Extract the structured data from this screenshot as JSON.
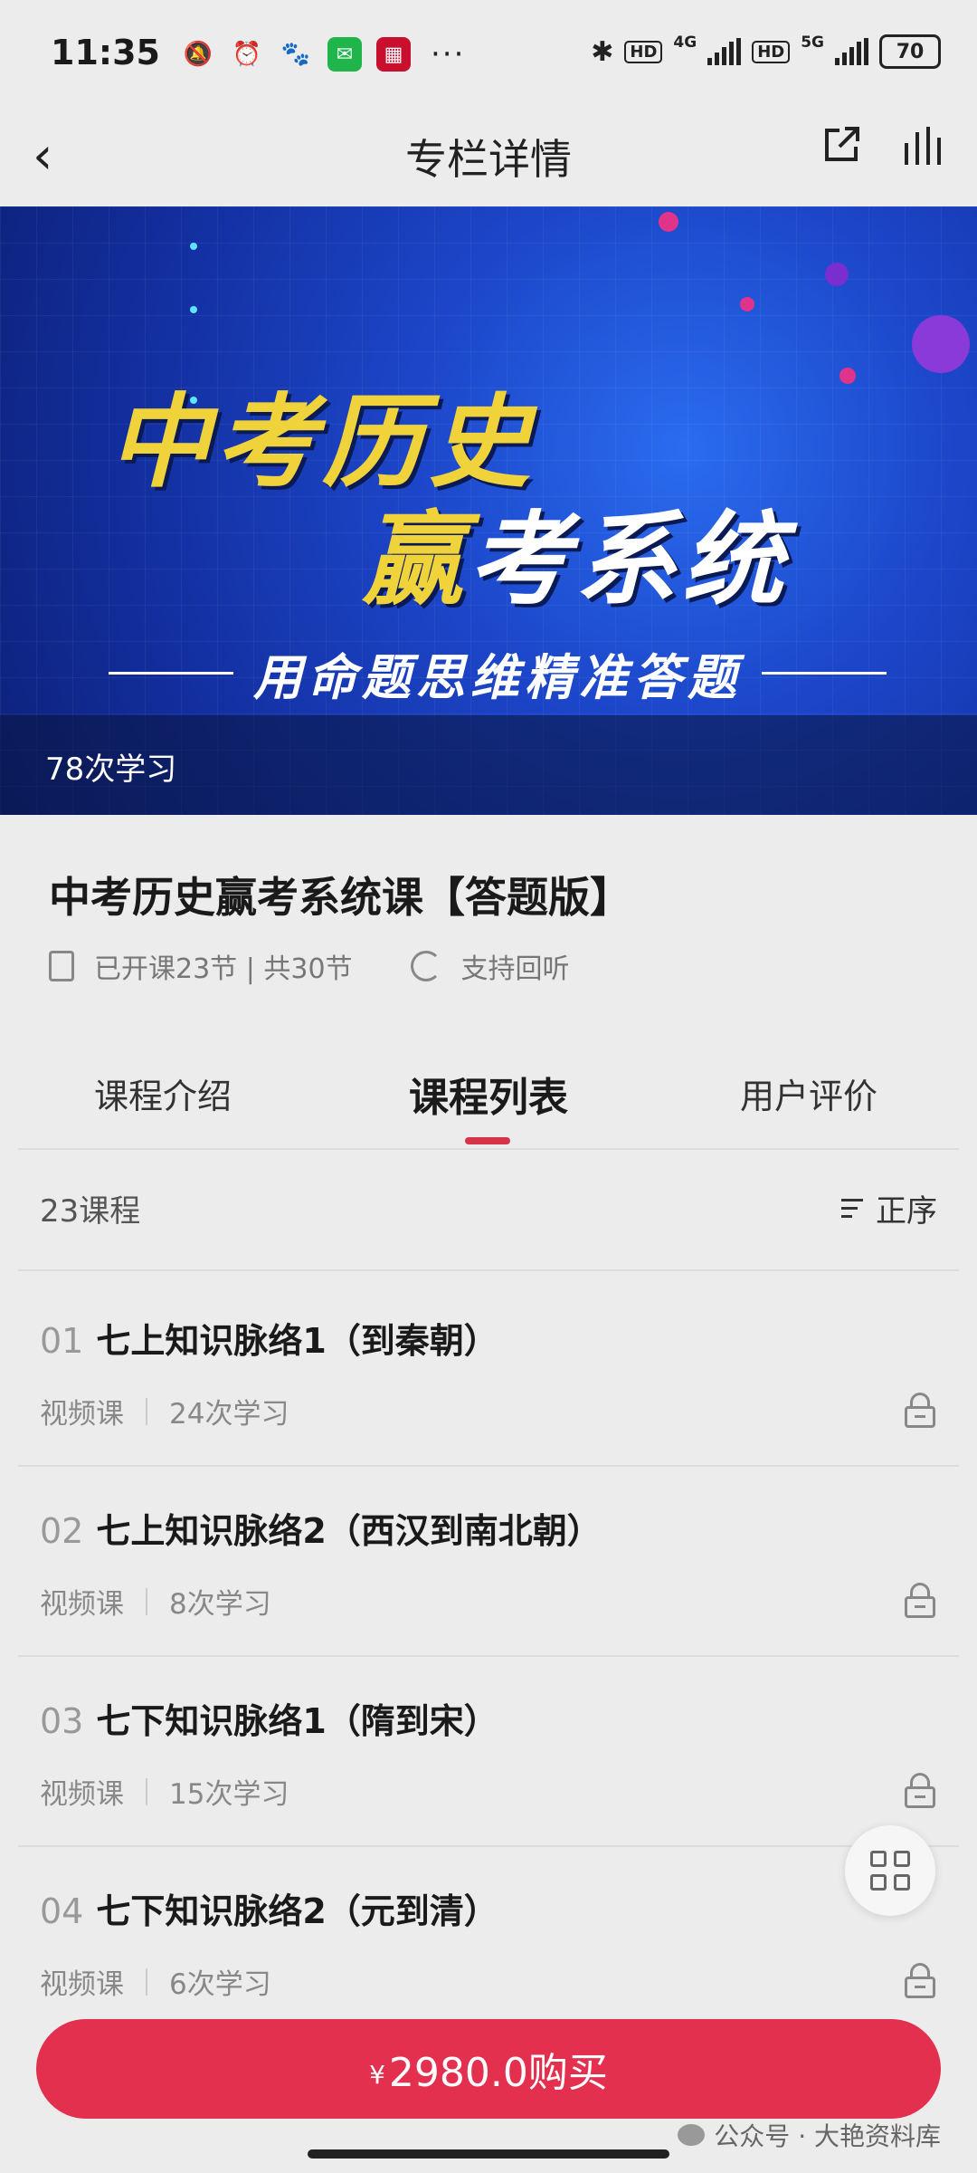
{
  "status_bar": {
    "time": "11:35",
    "network1": "4G",
    "network2": "5G",
    "hd": "HD",
    "battery": "70",
    "more": "···"
  },
  "header": {
    "title": "专栏详情",
    "back_icon": "‹"
  },
  "banner": {
    "title_line1": "中考历史",
    "title_line2_yellow": "赢",
    "title_line2_rest": "考系统",
    "subtitle": "用命题思维精准答题",
    "study_count": "78次学习"
  },
  "course": {
    "title": "中考历史赢考系统课【答题版】",
    "lessons_info": "已开课23节 | 共30节",
    "replay": "支持回听"
  },
  "tabs": [
    {
      "label": "课程介绍"
    },
    {
      "label": "课程列表"
    },
    {
      "label": "用户评价"
    }
  ],
  "list": {
    "count_label": "23课程",
    "sort_label": "正序",
    "items": [
      {
        "num": "01",
        "title": "七上知识脉络1（到秦朝）",
        "type": "视频课",
        "views": "24次学习"
      },
      {
        "num": "02",
        "title": "七上知识脉络2（西汉到南北朝）",
        "type": "视频课",
        "views": "8次学习"
      },
      {
        "num": "03",
        "title": "七下知识脉络1（隋到宋）",
        "type": "视频课",
        "views": "15次学习"
      },
      {
        "num": "04",
        "title": "七下知识脉络2（元到清）",
        "type": "视频课",
        "views": "6次学习"
      }
    ]
  },
  "buy": {
    "currency": "¥",
    "label": "2980.0购买"
  },
  "watermark": "公众号 · 大艳资料库",
  "colors": {
    "accent": "#e3304e",
    "background": "#ececec"
  }
}
